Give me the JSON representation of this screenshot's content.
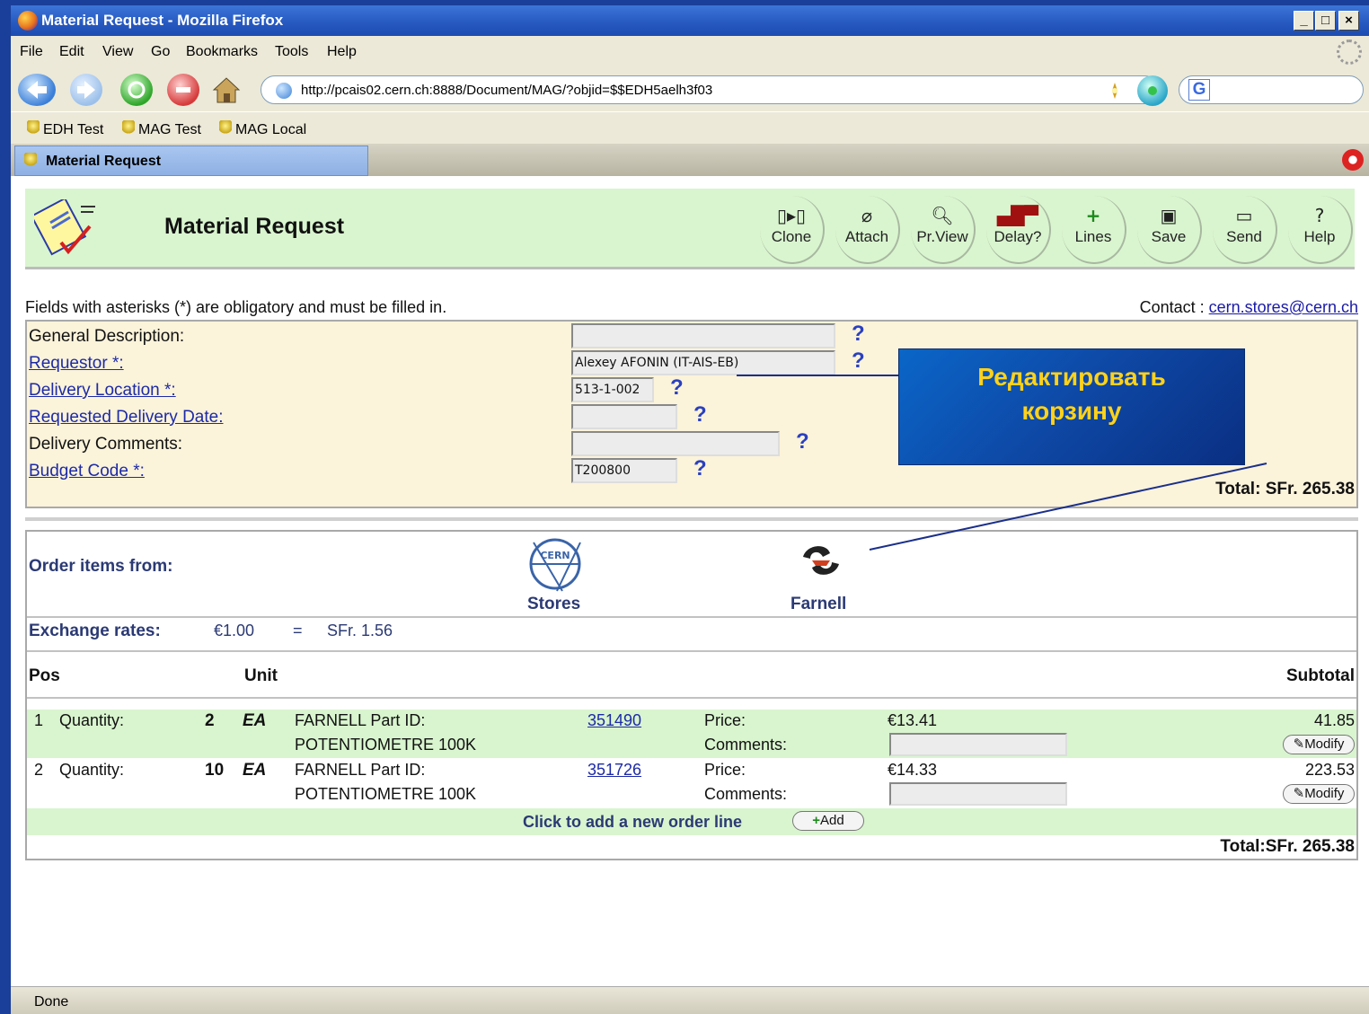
{
  "window": {
    "title": "Material Request - Mozilla Firefox",
    "min": "_",
    "max": "□",
    "close": "×"
  },
  "menu": [
    "File",
    "Edit",
    "View",
    "Go",
    "Bookmarks",
    "Tools",
    "Help"
  ],
  "nav": {
    "url": "http://pcais02.cern.ch:8888/Document/MAG/?objid=$$EDH5aelh3f03",
    "search_placeholder": ""
  },
  "bookmarks": [
    "EDH Test",
    "MAG Test",
    "MAG Local"
  ],
  "tab": {
    "label": "Material Request"
  },
  "header": {
    "title": "Material Request",
    "buttons": [
      {
        "icon": "clone-icon",
        "label": "Clone"
      },
      {
        "icon": "paperclip-icon",
        "label": "Attach"
      },
      {
        "icon": "print-preview-icon",
        "label": "Pr.View"
      },
      {
        "icon": "truck-icon",
        "label": "Delay?"
      },
      {
        "icon": "plus-icon",
        "label": "Lines"
      },
      {
        "icon": "save-icon",
        "label": "Save"
      },
      {
        "icon": "send-icon",
        "label": "Send"
      },
      {
        "icon": "help-icon",
        "label": "Help"
      }
    ]
  },
  "info": {
    "text": "Fields with asterisks (*) are obligatory and must be filled in.",
    "contact_label": "Contact :",
    "contact_email": "cern.stores@cern.ch"
  },
  "form": {
    "fields": [
      {
        "label": "General Description:",
        "value": ""
      },
      {
        "label": "Requestor *:",
        "value": "Alexey AFONIN (IT-AIS-EB)"
      },
      {
        "label": "Delivery Location *:",
        "value": "513-1-002"
      },
      {
        "label": "Requested Delivery Date:",
        "value": ""
      },
      {
        "label": "Delivery Comments:",
        "value": ""
      },
      {
        "label": "Budget Code *:",
        "value": "T200800"
      }
    ],
    "help": "?",
    "total": "Total: SFr. 265.38"
  },
  "order": {
    "from_label": "Order items from:",
    "suppliers": [
      "Stores",
      "Farnell"
    ],
    "stores_logo_text": "CERN",
    "exchange_label": "Exchange rates:",
    "exchange_eur": "€1.00",
    "exchange_eq": "=",
    "exchange_sfr": "SFr. 1.56",
    "col_pos": "Pos",
    "col_unit": "Unit",
    "col_subtotal": "Subtotal",
    "items": [
      {
        "pos": "1",
        "qty_label": "Quantity:",
        "qty": "2",
        "unit": "EA",
        "part_label": "FARNELL Part ID:",
        "desc": "POTENTIOMETRE 100K",
        "part_id": "351490",
        "price_label": "Price:",
        "comments_label": "Comments:",
        "price": "€13.41",
        "subtotal": "41.85",
        "modify": "Modify"
      },
      {
        "pos": "2",
        "qty_label": "Quantity:",
        "qty": "10",
        "unit": "EA",
        "part_label": "FARNELL Part ID:",
        "desc": "POTENTIOMETRE 100K",
        "part_id": "351726",
        "price_label": "Price:",
        "comments_label": "Comments:",
        "price": "€14.33",
        "subtotal": "223.53",
        "modify": "Modify"
      }
    ],
    "add_text": "Click to add a new order line",
    "add_button": "Add",
    "total": "Total:SFr. 265.38"
  },
  "callout": {
    "line1": "Редактировать",
    "line2": "корзину"
  },
  "status": "Done",
  "colors": {
    "header_bg": "#d9f5cf",
    "form_bg": "#fbf3da",
    "titlebar": "#2658c0",
    "callout_text": "#ffd21a",
    "link": "#1d2aa6"
  }
}
